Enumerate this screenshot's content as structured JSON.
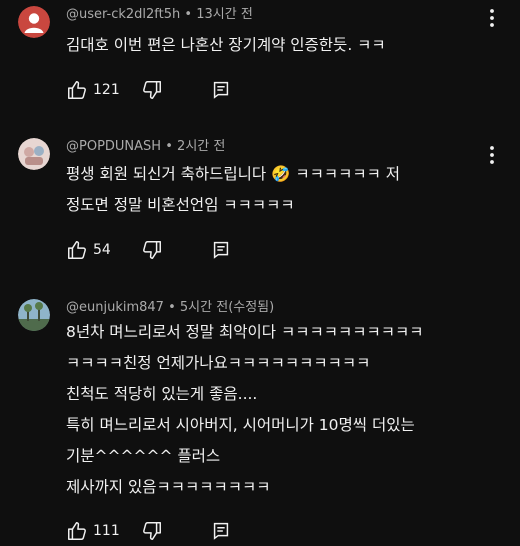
{
  "comments": [
    {
      "handle": "@user-ck2dl2ft5h",
      "sep": "•",
      "time": "13시간 전",
      "lines": [
        "김대호 이번 편은 나혼산 장기계약 인증한듯. ㅋㅋ"
      ],
      "likes": "121",
      "avatar_color": "#c9473f"
    },
    {
      "handle": "@POPDUNASH",
      "sep": "•",
      "time": "2시간 전",
      "lines": [
        "평생 회원 되신거 축하드립니다 🤣 ㅋㅋㅋㅋㅋㅋ 저",
        "정도면 정말 비혼선언임 ㅋㅋㅋㅋㅋ"
      ],
      "likes": "54",
      "avatar_color": "#e7d6d2"
    },
    {
      "handle": "@eunjukim847",
      "sep": "•",
      "time": "5시간 전(수정됨)",
      "lines": [
        "8년차 며느리로서 정말 최악이다 ㅋㅋㅋㅋㅋㅋㅋㅋㅋㅋ",
        "ㅋㅋㅋㅋ친정 언제가나요ㅋㅋㅋㅋㅋㅋㅋㅋㅋㅋ",
        "친척도 적당히 있는게 좋음....",
        "특히 며느리로서 시아버지, 시어머니가 10명씩 더있는",
        "기분^^^^^^ 플러스",
        "제사까지 있음ㅋㅋㅋㅋㅋㅋㅋㅋ"
      ],
      "likes": "111",
      "avatar_color": "#8fb4c9"
    }
  ],
  "icons": {
    "like": "thumbs-up-icon",
    "dislike": "thumbs-down-icon",
    "reply": "reply-icon",
    "more": "more-vert-icon"
  }
}
